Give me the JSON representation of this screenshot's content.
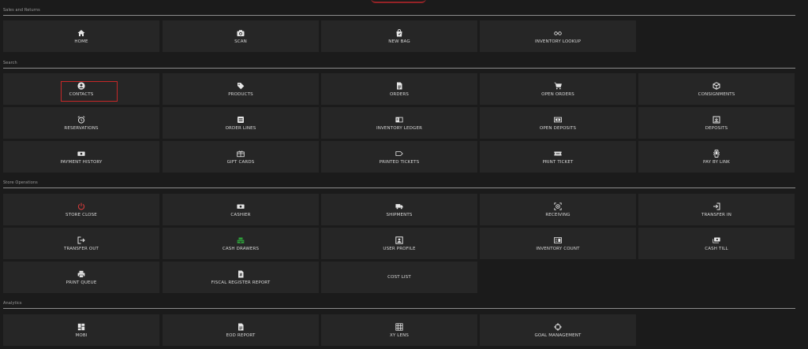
{
  "sections": {
    "sales": "Sales and Returns",
    "search": "Search",
    "store_ops": "Store Operations",
    "analytics": "Analytics"
  },
  "tiles": {
    "home": {
      "label": "HOME",
      "icon": "home-icon"
    },
    "scan": {
      "label": "SCAN",
      "icon": "camera-icon"
    },
    "new_bag": {
      "label": "NEW BAG",
      "icon": "bag-icon"
    },
    "inventory_lookup": {
      "label": "INVENTORY LOOKUP",
      "icon": "glasses-icon"
    },
    "contacts": {
      "label": "CONTACTS",
      "icon": "user-icon"
    },
    "products": {
      "label": "PRODUCTS",
      "icon": "tag-icon"
    },
    "orders": {
      "label": "ORDERS",
      "icon": "document-icon"
    },
    "open_orders": {
      "label": "OPEN ORDERS",
      "icon": "cart-icon"
    },
    "consignments": {
      "label": "CONSIGNMENTS",
      "icon": "box-icon"
    },
    "reservations": {
      "label": "RESERVATIONS",
      "icon": "alarm-clock-icon"
    },
    "order_lines": {
      "label": "ORDER LINES",
      "icon": "list-icon"
    },
    "inventory_ledger": {
      "label": "INVENTORY LEDGER",
      "icon": "ledger-icon"
    },
    "open_deposits": {
      "label": "OPEN DEPOSITS",
      "icon": "deposit-icon"
    },
    "deposits": {
      "label": "DEPOSITS",
      "icon": "deposit-box-icon"
    },
    "payment_history": {
      "label": "PAYMENT HISTORY",
      "icon": "cash-icon"
    },
    "gift_cards": {
      "label": "GIFT CARDS",
      "icon": "gift-icon"
    },
    "printed_tickets": {
      "label": "PRINTED TICKETS",
      "icon": "label-icon"
    },
    "print_ticket": {
      "label": "PRINT TICKET",
      "icon": "ticket-icon"
    },
    "pay_by_link": {
      "label": "PAY BY LINK",
      "icon": "phone-pay-icon"
    },
    "store_close": {
      "label": "STORE CLOSE",
      "icon": "power-icon"
    },
    "cashier": {
      "label": "CASHIER",
      "icon": "cash-icon"
    },
    "shipments": {
      "label": "SHIPMENTS",
      "icon": "truck-icon"
    },
    "receiving": {
      "label": "RECEIVING",
      "icon": "receiving-icon"
    },
    "transfer_in": {
      "label": "TRANSFER IN",
      "icon": "login-icon"
    },
    "transfer_out": {
      "label": "TRANSFER OUT",
      "icon": "logout-icon"
    },
    "cash_drawers": {
      "label": "CASH DRAWERS",
      "icon": "cash-drawer-icon"
    },
    "user_profile": {
      "label": "USER PROFILE",
      "icon": "profile-icon"
    },
    "inventory_count": {
      "label": "INVENTORY COUNT",
      "icon": "count-icon"
    },
    "cash_till": {
      "label": "CASH TILL",
      "icon": "till-icon"
    },
    "print_queue": {
      "label": "PRINT QUEUE",
      "icon": "printer-icon"
    },
    "fiscal_register_report": {
      "label": "FISCAL REGISTER REPORT",
      "icon": "report-icon"
    },
    "cost_list": {
      "label": "COST LIST",
      "icon": ""
    },
    "mobi": {
      "label": "MOBI",
      "icon": "dashboard-icon"
    },
    "eod_report": {
      "label": "EOD REPORT",
      "icon": "document-icon"
    },
    "xy_lens": {
      "label": "XY LENS",
      "icon": "grid-icon"
    },
    "goal_management": {
      "label": "GOAL MANAGEMENT",
      "icon": "crosshair-icon"
    }
  },
  "colors": {
    "background": "#1b1b1b",
    "tile": "#262626",
    "text": "#d8d8d8",
    "accent_red": "#c62828",
    "accent_green": "#2e9e3a"
  }
}
